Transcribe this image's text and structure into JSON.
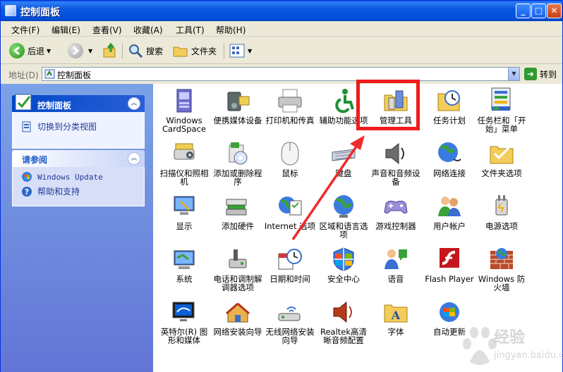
{
  "window": {
    "title": "控制面板"
  },
  "menu": [
    "文件(F)",
    "编辑(E)",
    "查看(V)",
    "收藏(A)",
    "工具(T)",
    "帮助(H)"
  ],
  "toolbar": {
    "back_label": "后退",
    "search_label": "搜索",
    "folders_label": "文件夹"
  },
  "address": {
    "label": "地址(D)",
    "value": "控制面板",
    "go_label": "转到"
  },
  "left_pane": {
    "control_panel": {
      "title": "控制面板",
      "switch_link": "切换到分类视图"
    },
    "see_also": {
      "title": "请参阅",
      "links": [
        "Windows Update",
        "帮助和支持"
      ]
    }
  },
  "items": [
    {
      "label": "Windows CardSpace",
      "icon": "cardspace-icon"
    },
    {
      "label": "便携媒体设备",
      "icon": "media-device-icon"
    },
    {
      "label": "打印机和传真",
      "icon": "printer-icon"
    },
    {
      "label": "辅助功能选项",
      "icon": "accessibility-icon"
    },
    {
      "label": "管理工具",
      "icon": "admin-tools-icon"
    },
    {
      "label": "任务计划",
      "icon": "task-scheduler-icon"
    },
    {
      "label": "任务栏和「开始」菜单",
      "icon": "taskbar-icon"
    },
    {
      "label": "扫描仪和照相机",
      "icon": "scanner-icon"
    },
    {
      "label": "添加或删除程序",
      "icon": "add-remove-icon"
    },
    {
      "label": "鼠标",
      "icon": "mouse-icon"
    },
    {
      "label": "键盘",
      "icon": "keyboard-icon"
    },
    {
      "label": "声音和音频设备",
      "icon": "sound-icon"
    },
    {
      "label": "网络连接",
      "icon": "network-icon"
    },
    {
      "label": "文件夹选项",
      "icon": "folder-options-icon"
    },
    {
      "label": "显示",
      "icon": "display-icon"
    },
    {
      "label": "添加硬件",
      "icon": "add-hardware-icon"
    },
    {
      "label": "Internet 选项",
      "icon": "internet-options-icon"
    },
    {
      "label": "区域和语言选项",
      "icon": "region-icon"
    },
    {
      "label": "游戏控制器",
      "icon": "gamepad-icon"
    },
    {
      "label": "用户帐户",
      "icon": "users-icon"
    },
    {
      "label": "电源选项",
      "icon": "power-icon"
    },
    {
      "label": "系统",
      "icon": "system-icon"
    },
    {
      "label": "电话和调制解调器选项",
      "icon": "phone-modem-icon"
    },
    {
      "label": "日期和时间",
      "icon": "datetime-icon"
    },
    {
      "label": "安全中心",
      "icon": "security-center-icon"
    },
    {
      "label": "语音",
      "icon": "speech-icon"
    },
    {
      "label": "Flash Player",
      "icon": "flash-icon"
    },
    {
      "label": "Windows 防火墙",
      "icon": "firewall-icon"
    },
    {
      "label": "英特尔(R) 图形和媒体",
      "icon": "intel-graphics-icon"
    },
    {
      "label": "网络安装向导",
      "icon": "network-setup-icon"
    },
    {
      "label": "无线网络安装向导",
      "icon": "wireless-setup-icon"
    },
    {
      "label": "Realtek高清晰音频配置",
      "icon": "realtek-audio-icon"
    },
    {
      "label": "字体",
      "icon": "fonts-icon"
    },
    {
      "label": "自动更新",
      "icon": "auto-update-icon"
    }
  ],
  "watermark": {
    "text1": "经验",
    "text2": "jingyan.baidu.com"
  },
  "colors": {
    "highlight": "#ef1b1b",
    "titlebar": "#0a58e0",
    "pane": "#6f8fe0"
  }
}
